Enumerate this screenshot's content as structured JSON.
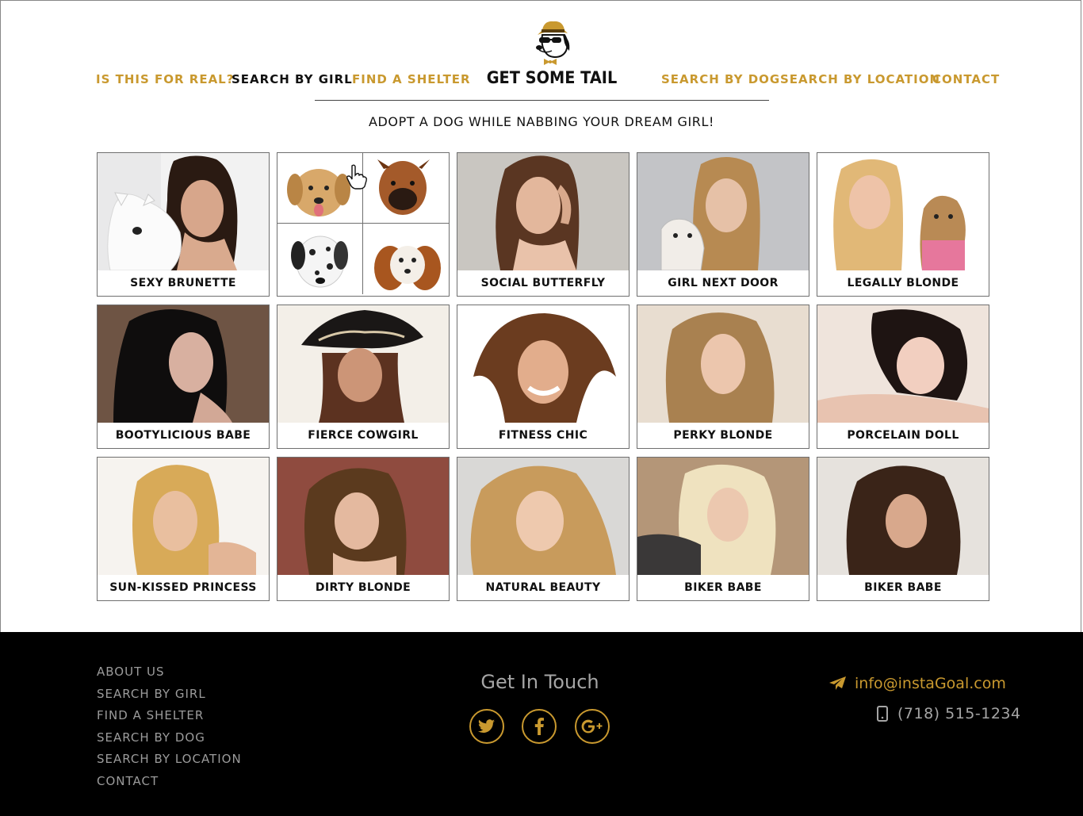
{
  "header": {
    "nav_left": [
      "IS THIS FOR REAL?",
      "SEARCH BY GIRL",
      "FIND A SHELTER"
    ],
    "nav_right": [
      "SEARCH BY DOG",
      "SEARCH BY LOCATION",
      "CONTACT"
    ],
    "logo_text": "GET SOME TAIL",
    "tagline": "ADOPT A DOG WHILE NABBING YOUR DREAM GIRL!",
    "active_item": "SEARCH BY GIRL"
  },
  "grid": {
    "cards": [
      {
        "label": "SEXY BRUNETTE"
      },
      {
        "label": ""
      },
      {
        "label": "SOCIAL BUTTERFLY"
      },
      {
        "label": "GIRL NEXT DOOR"
      },
      {
        "label": "LEGALLY BLONDE"
      },
      {
        "label": "BOOTYLICIOUS BABE"
      },
      {
        "label": "FIERCE COWGIRL"
      },
      {
        "label": "FITNESS CHIC"
      },
      {
        "label": "PERKY BLONDE"
      },
      {
        "label": "PORCELAIN DOLL"
      },
      {
        "label": "SUN-KISSED PRINCESS"
      },
      {
        "label": "DIRTY BLONDE"
      },
      {
        "label": "NATURAL BEAUTY"
      },
      {
        "label": "BIKER BABE"
      },
      {
        "label": "BIKER BABE"
      }
    ]
  },
  "footer": {
    "links": [
      "ABOUT US",
      "SEARCH BY GIRL",
      "FIND A SHELTER",
      "SEARCH BY DOG",
      "SEARCH BY  LOCATION",
      "CONTACT"
    ],
    "get_in_touch": "Get In Touch",
    "email": "info@instaGoal.com",
    "phone": "(718) 515-1234",
    "social_icons": [
      "twitter-icon",
      "facebook-icon",
      "google-plus-icon"
    ]
  },
  "colors": {
    "accent": "#c9992f",
    "text_dark": "#111111",
    "footer_bg": "#000000",
    "footer_text": "#9b9b9b"
  }
}
